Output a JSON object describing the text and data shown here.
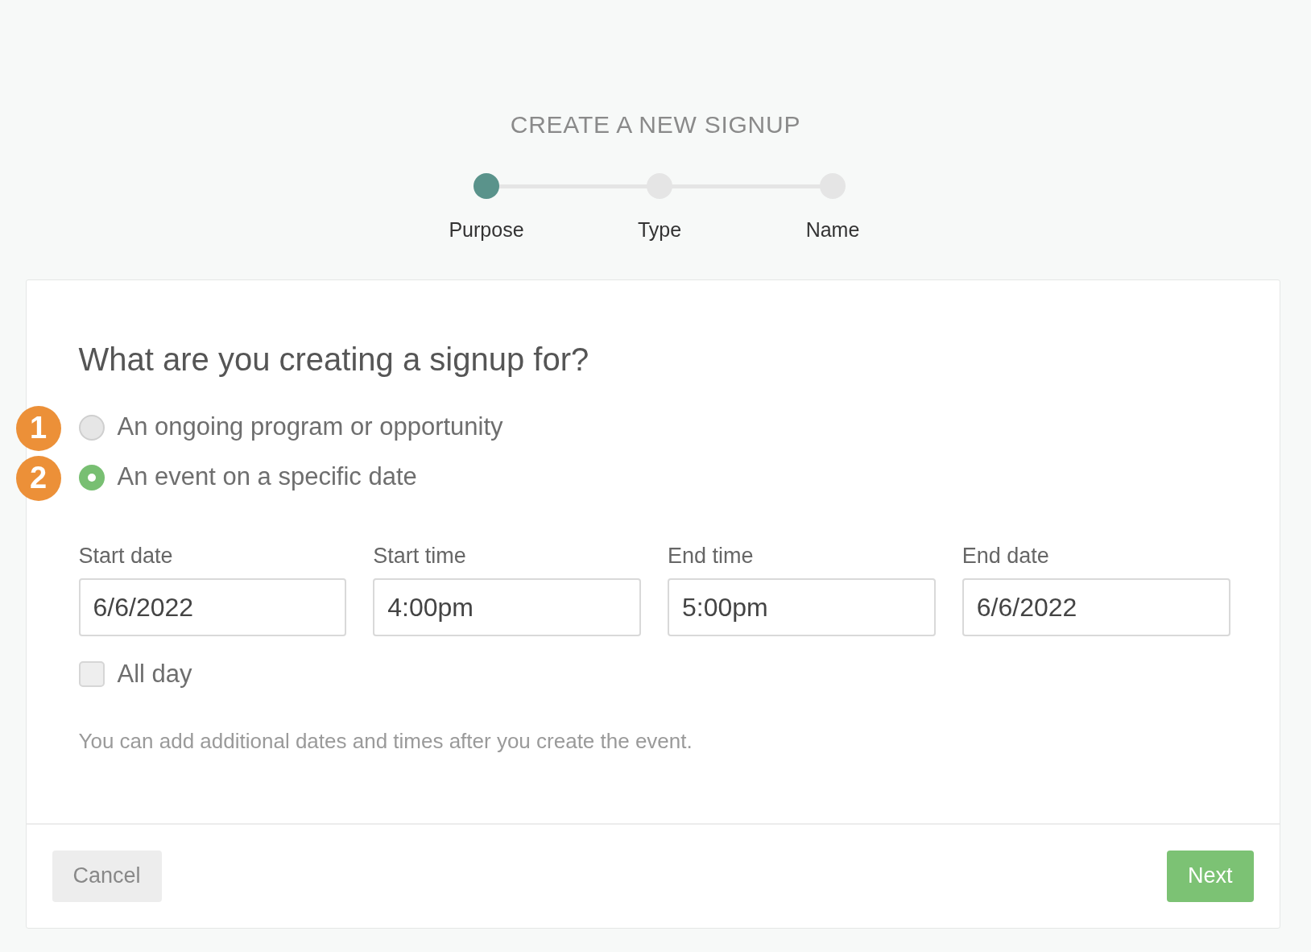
{
  "title": "CREATE A NEW SIGNUP",
  "steps": [
    {
      "label": "Purpose",
      "selected": true
    },
    {
      "label": "Type",
      "selected": false
    },
    {
      "label": "Name",
      "selected": false
    }
  ],
  "question": "What are you creating a signup for?",
  "options": [
    {
      "label": "An ongoing program or opportunity",
      "selected": false,
      "annotation": "1"
    },
    {
      "label": "An event on a specific date",
      "selected": true,
      "annotation": "2"
    }
  ],
  "fields": [
    {
      "label": "Start date",
      "value": "6/6/2022"
    },
    {
      "label": "Start time",
      "value": "4:00pm"
    },
    {
      "label": "End time",
      "value": "5:00pm"
    },
    {
      "label": "End date",
      "value": "6/6/2022"
    }
  ],
  "all_day": {
    "label": "All day",
    "checked": false
  },
  "hint": "You can add additional dates and times after you create the event.",
  "buttons": {
    "cancel": "Cancel",
    "next": "Next"
  }
}
